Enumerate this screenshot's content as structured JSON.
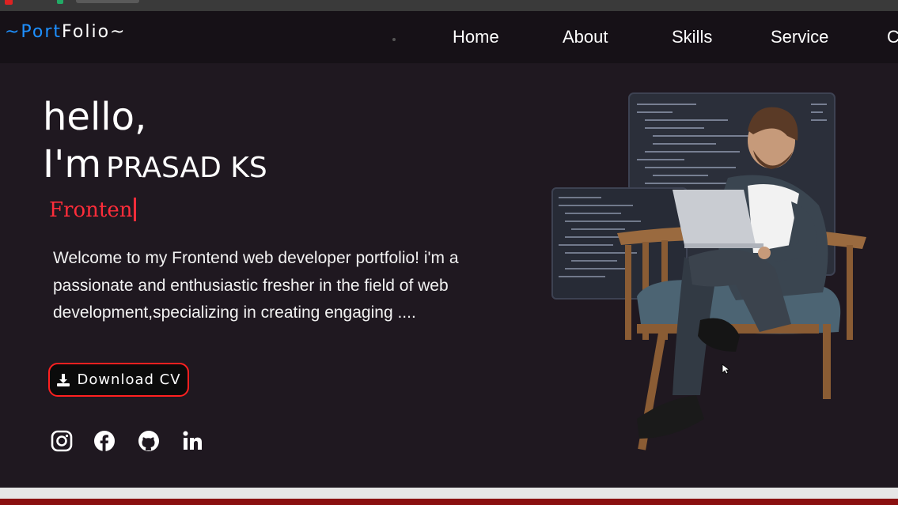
{
  "nav": {
    "logo_prefix": "~Port",
    "logo_suffix": "Folio~",
    "links": [
      "Home",
      "About",
      "Skills",
      "Service",
      "C"
    ]
  },
  "hero": {
    "greeting": "hello,",
    "im": "I'm",
    "name": "PRASAD KS",
    "typed_text": "Fronten",
    "intro": "Welcome to my Frontend web developer portfolio! i'm a passionate and enthusiastic fresher in the field of web development,specializing in creating engaging ....",
    "cv_button": "Download CV"
  },
  "social": [
    "instagram-icon",
    "facebook-icon",
    "github-icon",
    "linkedin-icon"
  ],
  "colors": {
    "background": "#1f1820",
    "navbar": "#161117",
    "accent_red": "#ff2d3a",
    "logo_blue": "#1e90ff"
  }
}
